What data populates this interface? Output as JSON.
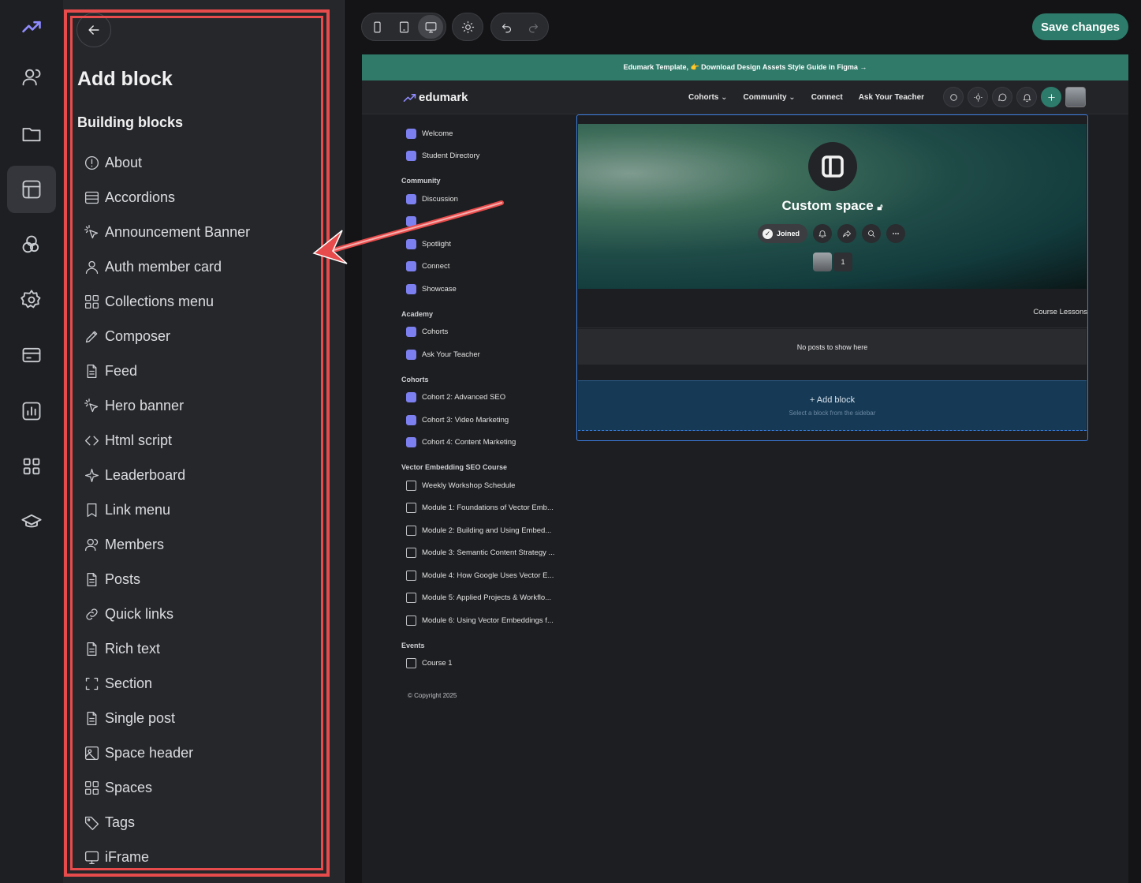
{
  "rail": {
    "items": [
      {
        "icon": "trending-up-icon"
      },
      {
        "icon": "users-icon"
      },
      {
        "icon": "folder-icon"
      },
      {
        "icon": "layout-icon",
        "active": true
      },
      {
        "icon": "palette-icon"
      },
      {
        "icon": "settings-icon"
      },
      {
        "icon": "credit-card-icon"
      },
      {
        "icon": "analytics-icon"
      },
      {
        "icon": "apps-icon"
      },
      {
        "icon": "graduation-cap-icon"
      }
    ]
  },
  "panel": {
    "title": "Add block",
    "subtitle": "Building blocks",
    "blocks": [
      {
        "label": "About",
        "icon": "info-circle-icon"
      },
      {
        "label": "Accordions",
        "icon": "accordion-icon"
      },
      {
        "label": "Announcement Banner",
        "icon": "cursor-click-icon"
      },
      {
        "label": "Auth member card",
        "icon": "user-icon"
      },
      {
        "label": "Collections menu",
        "icon": "grid-icon"
      },
      {
        "label": "Composer",
        "icon": "pencil-icon"
      },
      {
        "label": "Feed",
        "icon": "document-icon"
      },
      {
        "label": "Hero banner",
        "icon": "cursor-click-icon"
      },
      {
        "label": "Html script",
        "icon": "code-icon"
      },
      {
        "label": "Leaderboard",
        "icon": "sparkle-icon"
      },
      {
        "label": "Link menu",
        "icon": "bookmark-icon"
      },
      {
        "label": "Members",
        "icon": "users-icon"
      },
      {
        "label": "Posts",
        "icon": "document-icon"
      },
      {
        "label": "Quick links",
        "icon": "link-icon"
      },
      {
        "label": "Rich text",
        "icon": "document-icon"
      },
      {
        "label": "Section",
        "icon": "section-bracket-icon"
      },
      {
        "label": "Single post",
        "icon": "document-icon"
      },
      {
        "label": "Space header",
        "icon": "image-icon"
      },
      {
        "label": "Spaces",
        "icon": "grid-icon"
      },
      {
        "label": "Tags",
        "icon": "tag-icon"
      },
      {
        "label": "iFrame",
        "icon": "monitor-icon"
      }
    ]
  },
  "toolbar": {
    "save_label": "Save changes",
    "devices": [
      "mobile-icon",
      "tablet-icon",
      "desktop-icon"
    ],
    "active_device": "desktop-icon"
  },
  "site": {
    "announcement": "Edumark Template, 👉 Download Design Assets Style Guide in Figma →",
    "logo_text": "edumark",
    "nav": [
      {
        "label": "Cohorts",
        "dropdown": true
      },
      {
        "label": "Community",
        "dropdown": true
      },
      {
        "label": "Connect",
        "dropdown": false
      },
      {
        "label": "Ask Your Teacher",
        "dropdown": false
      }
    ],
    "sidebar": {
      "top": [
        {
          "label": "Welcome"
        },
        {
          "label": "Student Directory"
        }
      ],
      "sections": [
        {
          "heading": "Community",
          "items": [
            {
              "label": "Discussion",
              "outline": false
            },
            {
              "label": "",
              "outline": false
            },
            {
              "label": "Spotlight",
              "outline": false
            },
            {
              "label": "Connect",
              "outline": false
            },
            {
              "label": "Showcase",
              "outline": false
            }
          ]
        },
        {
          "heading": "Academy",
          "items": [
            {
              "label": "Cohorts",
              "outline": false
            },
            {
              "label": "Ask Your Teacher",
              "outline": false
            }
          ]
        },
        {
          "heading": "Cohorts",
          "items": [
            {
              "label": "Cohort 2: Advanced SEO",
              "outline": false
            },
            {
              "label": "Cohort 3: Video Marketing",
              "outline": false
            },
            {
              "label": "Cohort 4: Content Marketing",
              "outline": false
            }
          ]
        },
        {
          "heading": "Vector Embedding SEO Course",
          "items": [
            {
              "label": "Weekly Workshop Schedule",
              "outline": true
            },
            {
              "label": "Module 1: Foundations of Vector Emb...",
              "outline": true
            },
            {
              "label": "Module 2: Building and Using Embed...",
              "outline": true
            },
            {
              "label": "Module 3: Semantic Content Strategy ...",
              "outline": true
            },
            {
              "label": "Module 4: How Google Uses Vector E...",
              "outline": true
            },
            {
              "label": "Module 5: Applied Projects & Workflo...",
              "outline": true
            },
            {
              "label": "Module 6: Using Vector Embeddings f...",
              "outline": true
            }
          ]
        },
        {
          "heading": "Events",
          "items": [
            {
              "label": "Course 1",
              "outline": true
            }
          ]
        }
      ],
      "copyright": "© Copyright 2025"
    },
    "space": {
      "title": "Custom space",
      "joined_label": "Joined",
      "member_count": "1",
      "tab_label": "Course Lessons",
      "empty_text": "No posts to show here",
      "add_block_label": "+ Add block",
      "add_block_hint": "Select a block from the sidebar"
    }
  },
  "colors": {
    "accent": "#2d7c6b",
    "highlight": "#e84b4b",
    "selection": "#3b7de0"
  }
}
